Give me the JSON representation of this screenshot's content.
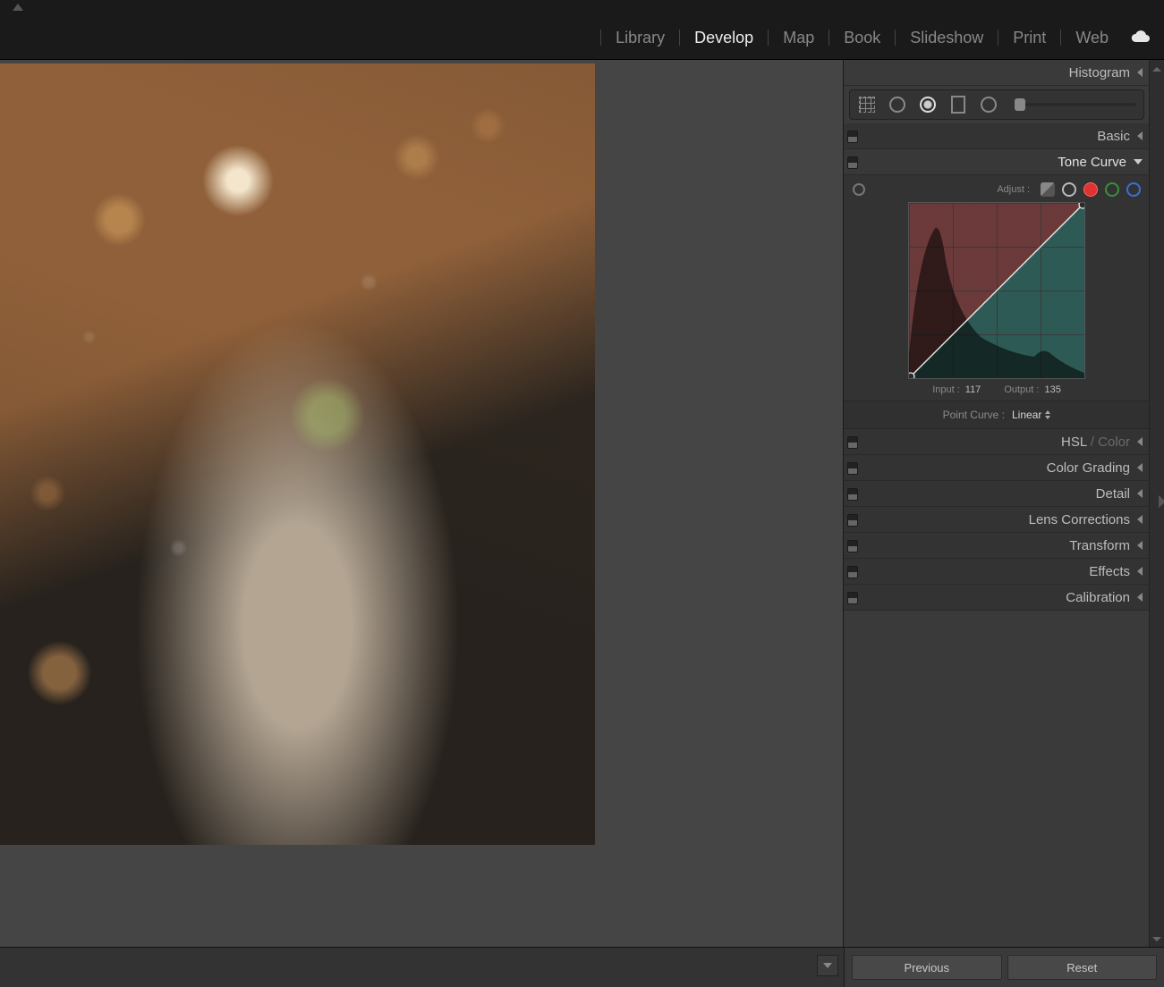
{
  "modules": {
    "library": "Library",
    "develop": "Develop",
    "map": "Map",
    "book": "Book",
    "slideshow": "Slideshow",
    "print": "Print",
    "web": "Web",
    "active": "develop"
  },
  "panels": {
    "histogram": "Histogram",
    "basic": "Basic",
    "tone_curve": "Tone Curve",
    "hsl": "HSL",
    "hsl_secondary": " / Color",
    "color_grading": "Color Grading",
    "detail": "Detail",
    "lens_corrections": "Lens Corrections",
    "transform": "Transform",
    "effects": "Effects",
    "calibration": "Calibration"
  },
  "tone_curve": {
    "adjust_label": "Adjust :",
    "input_label": "Input :",
    "input_value": "117",
    "output_label": "Output :",
    "output_value": "135",
    "point_curve_label": "Point Curve :",
    "point_curve_value": "Linear",
    "active_channel": "red"
  },
  "footer": {
    "previous": "Previous",
    "reset": "Reset"
  }
}
